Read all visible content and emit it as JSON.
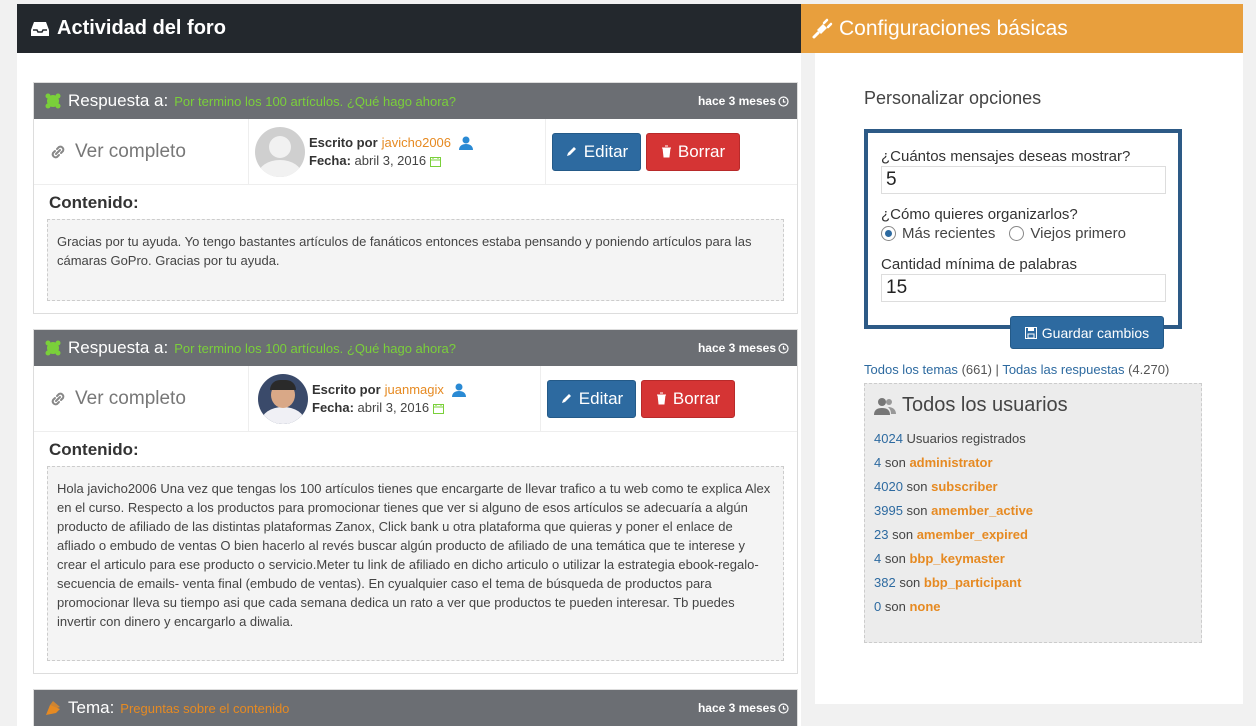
{
  "left": {
    "title": "Actividad del foro",
    "view_label": "Ver completo",
    "written_by": "Escrito por",
    "date_label": "Fecha:",
    "edit_label": "Editar",
    "delete_label": "Borrar",
    "content_label": "Contenido:",
    "cards": [
      {
        "type": "Respuesta a:",
        "topic": "Por termino los 100 artículos. ¿Qué hago ahora?",
        "time": "hace 3 meses",
        "author": "javicho2006",
        "date": "abril 3, 2016",
        "content": "Gracias por tu ayuda. Yo tengo bastantes artículos de fanáticos entonces estaba pensando y poniendo artículos para las cámaras GoPro. Gracias por tu ayuda."
      },
      {
        "type": "Respuesta a:",
        "topic": "Por termino los 100 artículos. ¿Qué hago ahora?",
        "time": "hace 3 meses",
        "author": "juanmagix",
        "date": "abril 3, 2016",
        "content": "Hola javicho2006 Una vez que tengas los 100 artículos tienes que encargarte de llevar trafico a tu web como te explica Alex en el curso. Respecto a los productos para promocionar tienes que ver si alguno de esos artículos se adecuaría a algún producto de afiliado de las distintas plataformas Zanox, Click bank u otra plataforma que quieras y poner el enlace de afliado o embudo de ventas O bien hacerlo al revés buscar algún producto de afiliado de una temática que te interese y crear el articulo para ese producto o servicio.Meter tu link de afiliado en dicho articulo o utilizar la estrategia ebook-regalo-secuencia de emails- venta final (embudo de ventas). En cyualquier caso el tema de búsqueda de productos para promocionar lleva su tiempo asi que cada semana dedica un rato a ver que productos te pueden interesar. Tb puedes invertir con dinero y encargarlo a diwalia."
      },
      {
        "type": "Tema:",
        "topic": "Preguntas sobre el contenido",
        "time": "hace 3 meses"
      }
    ]
  },
  "right": {
    "title": "Configuraciones básicas",
    "section_title": "Personalizar opciones",
    "q_count": "¿Cuántos mensajes deseas mostrar?",
    "count_value": "5",
    "q_order": "¿Cómo quieres organizarlos?",
    "order_options": [
      "Más recientes",
      "Viejos primero"
    ],
    "order_selected": "Más recientes",
    "q_words": "Cantidad mínima de palabras",
    "words_value": "15",
    "save_label": "Guardar cambios",
    "all_topics": "Todos los temas",
    "topics_count": "(661)",
    "separator": "|",
    "all_replies": "Todas las respuestas",
    "replies_count": "(4.270)",
    "users_title": "Todos los usuarios",
    "users_total": "4024",
    "users_total_label": "Usuarios registrados",
    "son": "son",
    "roles": [
      {
        "count": "4",
        "role": "administrator"
      },
      {
        "count": "4020",
        "role": "subscriber"
      },
      {
        "count": "3995",
        "role": "amember_active"
      },
      {
        "count": "23",
        "role": "amember_expired"
      },
      {
        "count": "4",
        "role": "bbp_keymaster"
      },
      {
        "count": "382",
        "role": "bbp_participant"
      },
      {
        "count": "0",
        "role": "none"
      }
    ]
  },
  "colors": {
    "dark_header": "#23282d",
    "orange_header": "#e89f3d",
    "card_header": "#6b6e73",
    "green_link": "#7ad03a",
    "orange_link": "#e68a22",
    "blue_button": "#2d6aa0",
    "red_button": "#d53434"
  }
}
